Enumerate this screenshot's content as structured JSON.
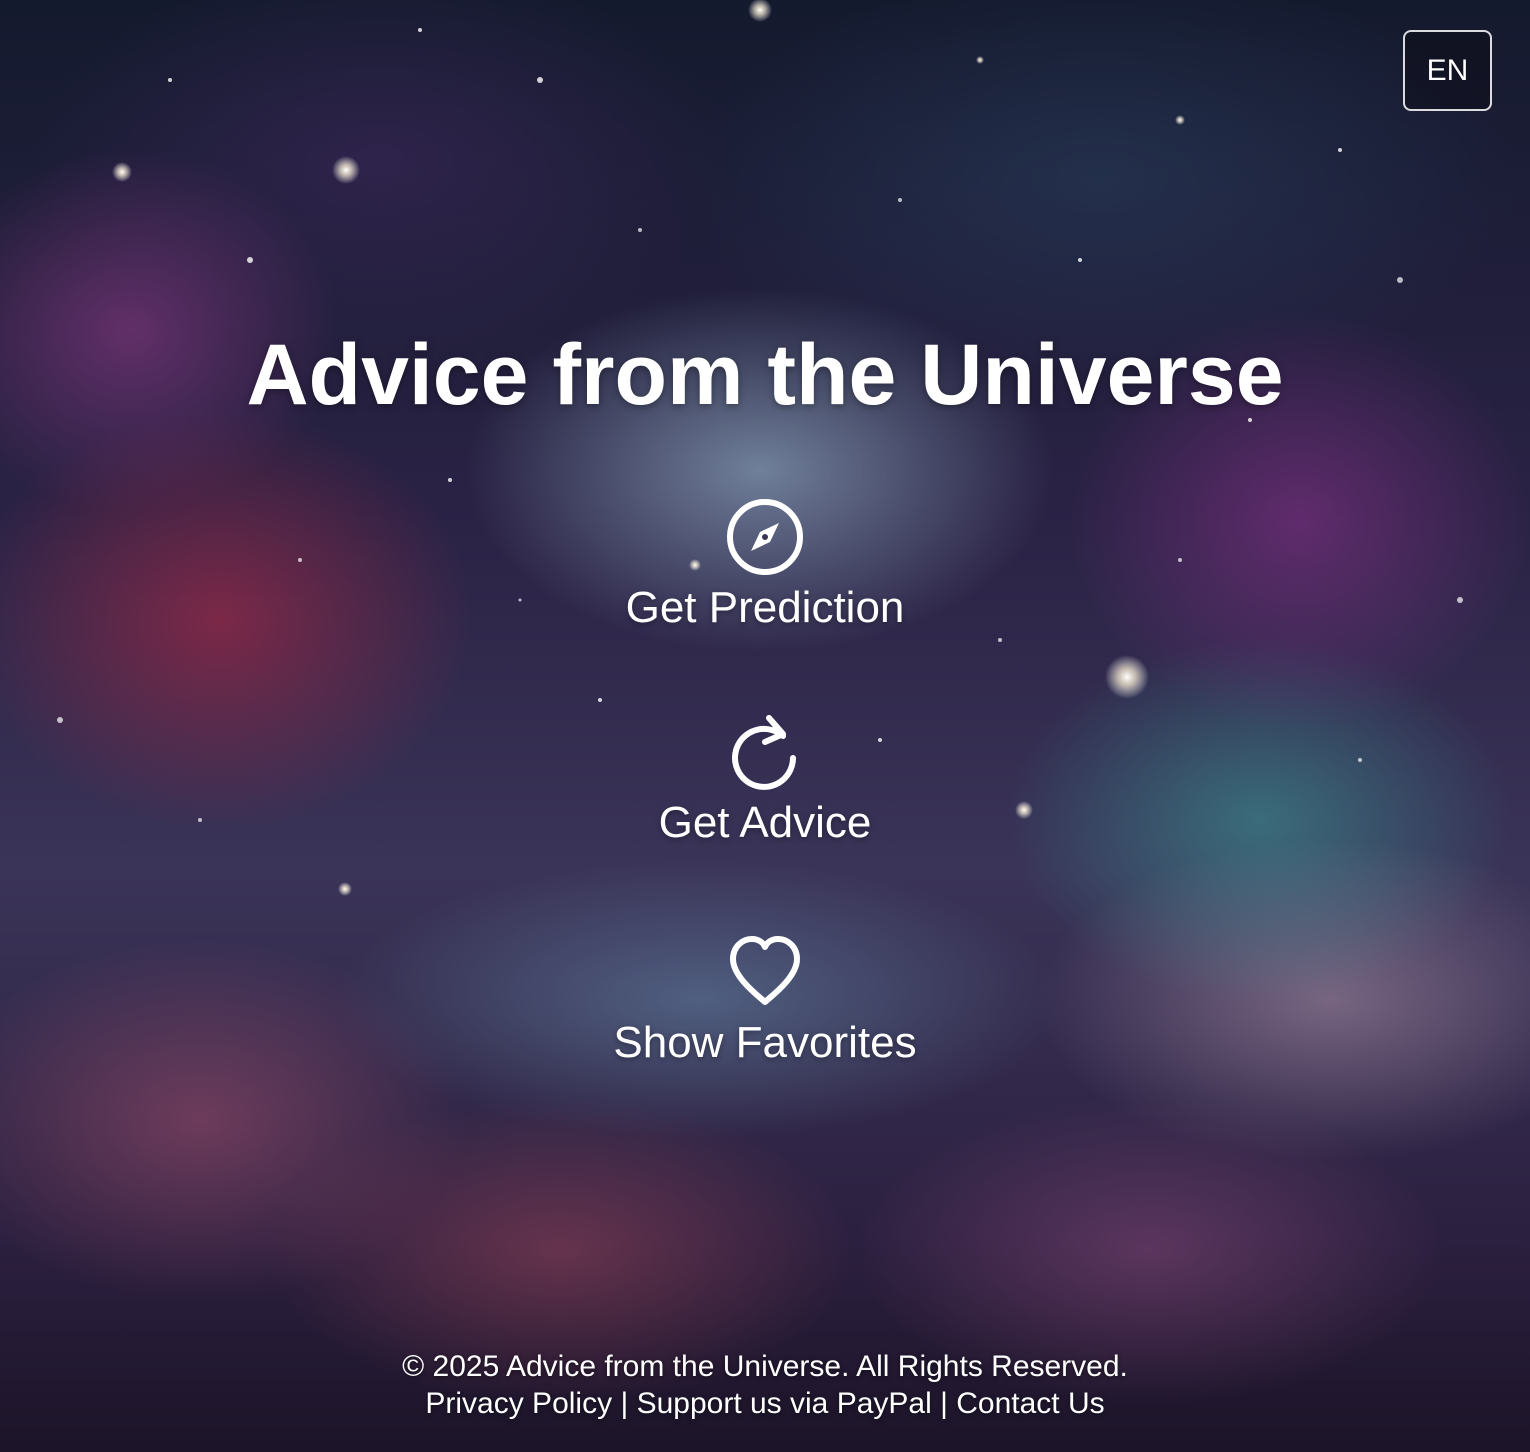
{
  "language_button": {
    "label": "EN"
  },
  "header": {
    "title": "Advice from the Universe"
  },
  "actions": [
    {
      "label": "Get Prediction",
      "icon": "compass-icon"
    },
    {
      "label": "Get Advice",
      "icon": "refresh-icon"
    },
    {
      "label": "Show Favorites",
      "icon": "heart-icon"
    }
  ],
  "footer": {
    "copyright": "© 2025 Advice from the Universe. All Rights Reserved.",
    "links": [
      {
        "label": "Privacy Policy"
      },
      {
        "label": "Support us via PayPal"
      },
      {
        "label": "Contact Us"
      }
    ],
    "separator": "|"
  },
  "colors": {
    "text": "#ffffff",
    "button_border": "#ffffff"
  }
}
